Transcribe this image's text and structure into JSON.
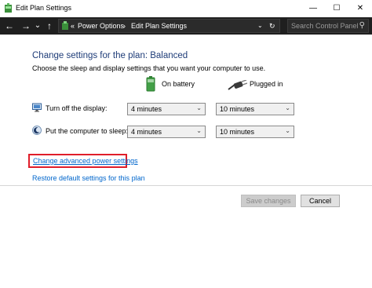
{
  "window": {
    "title": "Edit Plan Settings"
  },
  "nav": {
    "back": "←",
    "forward": "→",
    "dropdown": "⌄",
    "up": "↑",
    "breadcrumb": [
      "Power Options",
      "Edit Plan Settings"
    ],
    "chevron": "«",
    "separator": "›",
    "refresh": "↻",
    "search_placeholder": "Search Control Panel"
  },
  "page": {
    "heading": "Change settings for the plan: Balanced",
    "subheading": "Choose the sleep and display settings that you want your computer to use.",
    "columns": {
      "battery": "On battery",
      "plugged": "Plugged in"
    },
    "rows": [
      {
        "label": "Turn off the display:",
        "battery": "4 minutes",
        "plugged": "10 minutes"
      },
      {
        "label": "Put the computer to sleep:",
        "battery": "4 minutes",
        "plugged": "10 minutes"
      }
    ],
    "links": {
      "advanced": "Change advanced power settings",
      "restore": "Restore default settings for this plan"
    },
    "buttons": {
      "save": "Save changes",
      "cancel": "Cancel"
    }
  },
  "colors": {
    "heading": "#1e3c78",
    "link": "#0066cc",
    "highlight_box": "#e01e2a",
    "navbar": "#1f1f1f"
  }
}
